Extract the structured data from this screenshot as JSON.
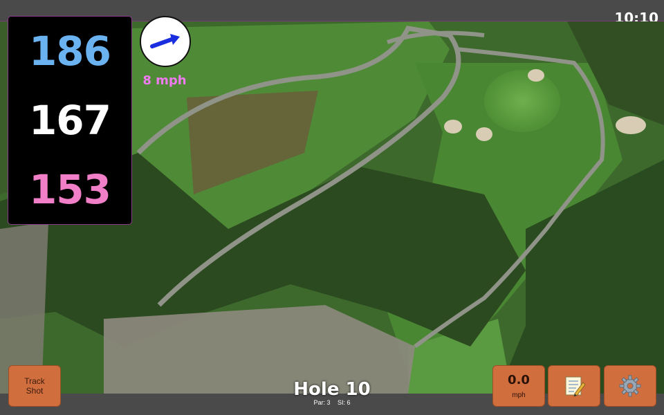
{
  "status": {
    "time": "10:10"
  },
  "yardage": {
    "back": "186",
    "middle": "167",
    "front": "153"
  },
  "wind": {
    "speed": "8 mph",
    "direction_icon": "arrow-icon"
  },
  "hole": {
    "title": "Hole 10",
    "par": "Par: 3",
    "si": "SI: 6"
  },
  "buttons": {
    "track_shot_line1": "Track",
    "track_shot_line2": "Shot",
    "speed_value": "0.0",
    "speed_unit": "mph",
    "notes_icon": "notepad-icon",
    "settings_icon": "gear-icon"
  },
  "colors": {
    "back": "#6ab2f0",
    "middle": "#ffffff",
    "front": "#f07fc7",
    "wind_text": "#f07af0",
    "button": "#d06e3e",
    "arrow": "#1a2ee0"
  }
}
